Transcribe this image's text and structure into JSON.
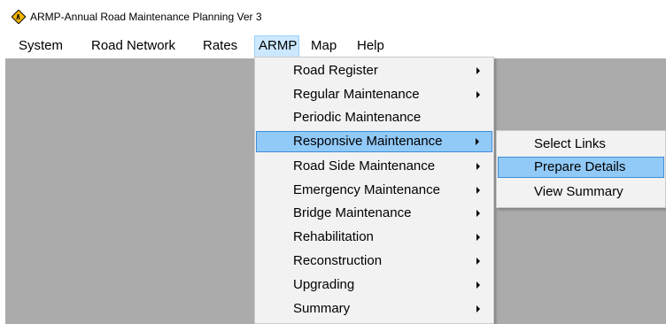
{
  "window": {
    "title": "ARMP-Annual Road Maintenance Planning Ver 3",
    "icon": "road-sign-icon"
  },
  "menubar": {
    "items": [
      {
        "label": "System"
      },
      {
        "label": "Road Network"
      },
      {
        "label": "Rates"
      },
      {
        "label": "ARMP",
        "open": true
      },
      {
        "label": "Map"
      },
      {
        "label": "Help"
      }
    ]
  },
  "armp_menu": {
    "items": [
      {
        "label": "Road Register",
        "submenu": true
      },
      {
        "label": "Regular Maintenance",
        "submenu": true
      },
      {
        "label": "Periodic Maintenance",
        "submenu": false
      },
      {
        "label": "Responsive Maintenance",
        "submenu": true,
        "highlighted": true
      },
      {
        "label": "Road Side Maintenance",
        "submenu": true
      },
      {
        "label": "Emergency Maintenance",
        "submenu": true
      },
      {
        "label": "Bridge Maintenance",
        "submenu": true
      },
      {
        "label": "Rehabilitation",
        "submenu": true
      },
      {
        "label": "Reconstruction",
        "submenu": true
      },
      {
        "label": "Upgrading",
        "submenu": true
      },
      {
        "label": "Summary",
        "submenu": true
      }
    ]
  },
  "responsive_submenu": {
    "items": [
      {
        "label": "Select Links"
      },
      {
        "label": "Prepare Details",
        "highlighted": true
      },
      {
        "label": "View Summary"
      }
    ]
  },
  "colors": {
    "workspace": "#ababab",
    "menu_bg": "#f2f2f2",
    "highlight": "#91c9f7",
    "open_menu": "#cce8ff"
  }
}
